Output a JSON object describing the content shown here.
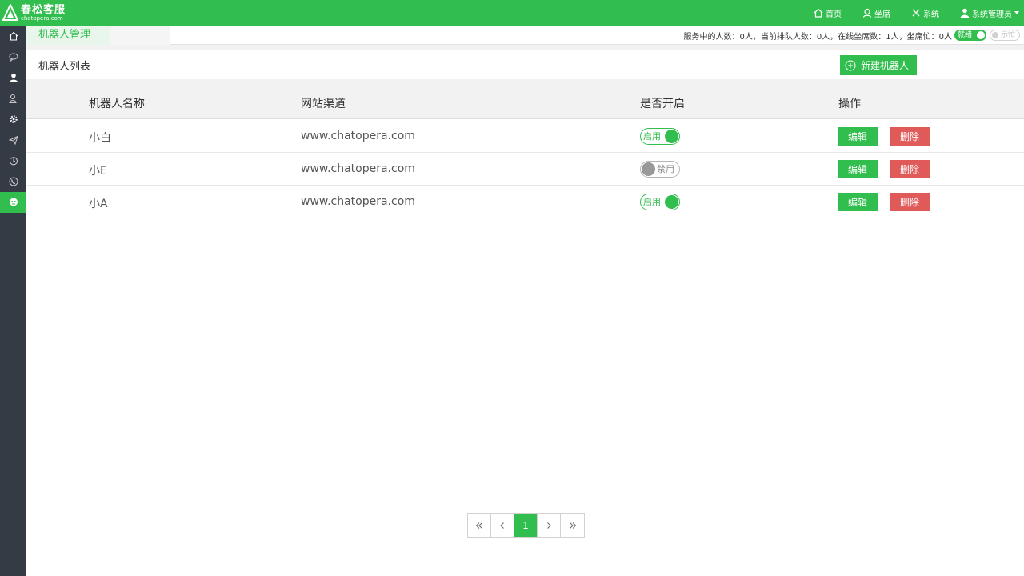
{
  "brand": {
    "title": "春松客服",
    "subtitle": "chatopera.com"
  },
  "topnav": [
    {
      "label": "首页",
      "icon": "home-icon"
    },
    {
      "label": "坐席",
      "icon": "agent-icon"
    },
    {
      "label": "系统",
      "icon": "tools-icon"
    },
    {
      "label": "系统管理员",
      "icon": "user-icon"
    }
  ],
  "sidebar": [
    {
      "icon": "home-icon"
    },
    {
      "icon": "chat-bubbles-icon"
    },
    {
      "icon": "person-icon"
    },
    {
      "icon": "contacts-icon"
    },
    {
      "icon": "gear-icon"
    },
    {
      "icon": "paper-plane-icon"
    },
    {
      "icon": "history-icon"
    },
    {
      "icon": "phone-icon"
    },
    {
      "icon": "robot-icon",
      "active": true
    }
  ],
  "tab": {
    "label": "机器人管理"
  },
  "status": {
    "text": "服务中的人数：0人，当前排队人数：0人，在线坐席数：1人，坐席忙：0人",
    "ready_label": "就绪",
    "busy_label": "示忙"
  },
  "page": {
    "list_title": "机器人列表",
    "new_button": "新建机器人"
  },
  "table": {
    "headers": [
      "机器人名称",
      "网站渠道",
      "是否开启",
      "操作"
    ],
    "rows": [
      {
        "name": "小白",
        "channel": "www.chatopera.com",
        "enabled": true,
        "switch_label": "启用"
      },
      {
        "name": "小E",
        "channel": "www.chatopera.com",
        "enabled": false,
        "switch_label": "禁用"
      },
      {
        "name": "小A",
        "channel": "www.chatopera.com",
        "enabled": true,
        "switch_label": "启用"
      }
    ],
    "edit_label": "编辑",
    "delete_label": "删除"
  },
  "pagination": {
    "current": "1"
  },
  "colors": {
    "brand_green": "#32be4e",
    "sidebar_dark": "#353b45",
    "danger_red": "#e05a5a"
  }
}
